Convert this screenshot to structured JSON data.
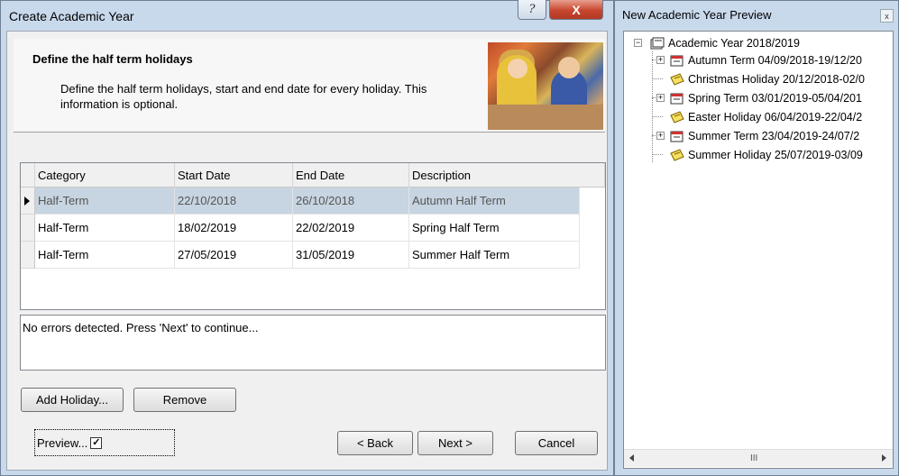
{
  "dialog": {
    "title": "Create Academic Year",
    "help_label": "?",
    "close_label": "X",
    "header": {
      "title": "Define the half term holidays",
      "description": "Define the half term holidays, start and end date for every holiday. This information is optional."
    },
    "grid": {
      "columns": [
        "Category",
        "Start Date",
        "End Date",
        "Description"
      ],
      "rows": [
        {
          "category": "Half-Term",
          "start": "22/10/2018",
          "end": "26/10/2018",
          "description": "Autumn Half Term",
          "selected": true
        },
        {
          "category": "Half-Term",
          "start": "18/02/2019",
          "end": "22/02/2019",
          "description": "Spring Half Term",
          "selected": false
        },
        {
          "category": "Half-Term",
          "start": "27/05/2019",
          "end": "31/05/2019",
          "description": "Summer Half Term",
          "selected": false
        }
      ]
    },
    "status_message": "No errors detected. Press 'Next' to continue...",
    "buttons": {
      "add_holiday": "Add Holiday...",
      "remove": "Remove",
      "preview": "Preview...",
      "preview_checked": true,
      "back": "< Back",
      "next": "Next >",
      "cancel": "Cancel"
    }
  },
  "preview_panel": {
    "title": "New Academic Year Preview",
    "close_label": "x",
    "tree": {
      "root": "Academic Year 2018/2019",
      "children": [
        {
          "label": "Autumn Term 04/09/2018-19/12/20",
          "type": "term",
          "expandable": true
        },
        {
          "label": "Christmas Holiday 20/12/2018-02/0",
          "type": "holiday",
          "expandable": false
        },
        {
          "label": "Spring Term 03/01/2019-05/04/201",
          "type": "term",
          "expandable": true
        },
        {
          "label": "Easter Holiday 06/04/2019-22/04/2",
          "type": "holiday",
          "expandable": false
        },
        {
          "label": "Summer Term 23/04/2019-24/07/2",
          "type": "term",
          "expandable": true
        },
        {
          "label": "Summer Holiday 25/07/2019-03/09",
          "type": "holiday",
          "expandable": false
        }
      ]
    },
    "scrollbar_grip": "III"
  },
  "colors": {
    "window_frame": "#c9d9ec",
    "selected_row": "#c7d4e1",
    "close_button": "#c7462e"
  }
}
